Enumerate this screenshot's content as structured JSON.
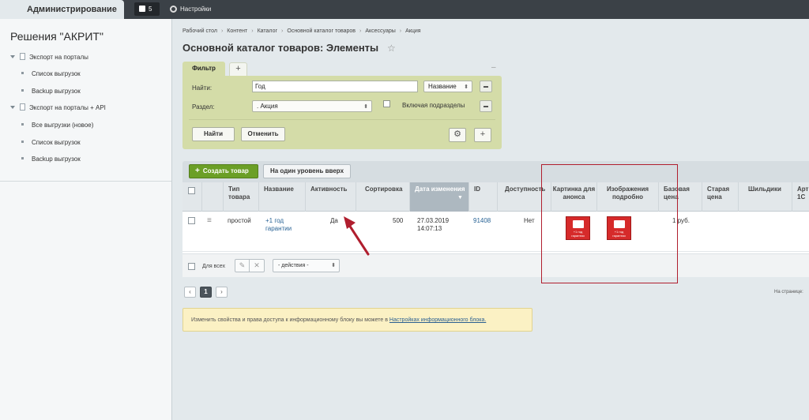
{
  "topbar": {
    "admin_tab": "Администрирование",
    "notif_count": "5",
    "settings": "Настройки"
  },
  "sidebar": {
    "title": "Решения \"АКРИТ\"",
    "items": [
      {
        "label": "Экспорт на порталы"
      },
      {
        "label": "Список выгрузок"
      },
      {
        "label": "Backup выгрузок"
      },
      {
        "label": "Экспорт на порталы + API"
      },
      {
        "label": "Все выгрузки (новое)"
      },
      {
        "label": "Список выгрузок"
      },
      {
        "label": "Backup выгрузок"
      }
    ]
  },
  "breadcrumb": [
    "Рабочий стол",
    "Контент",
    "Каталог",
    "Основной каталог товаров",
    "Аксессуары",
    "Акция"
  ],
  "page_title": "Основной каталог товаров: Элементы",
  "filter": {
    "tab": "Фильтр",
    "add_tab": "+",
    "minimize": "–",
    "find_label": "Найти:",
    "find_value": "Год",
    "find_field": "Название",
    "section_label": "Раздел:",
    "section_value": ". Акция",
    "include_sub": "Включая подразделы",
    "find_btn": "Найти",
    "cancel_btn": "Отменить",
    "plus": "+"
  },
  "toolbar": {
    "create": "Создать товар",
    "create_plus": "+",
    "up_level": "На один уровень вверх"
  },
  "table": {
    "headers": {
      "type": "Тип товара",
      "name": "Название",
      "active": "Активность",
      "sort": "Сортировка",
      "date": "Дата изменения",
      "date_arrow": "▼",
      "id": "ID",
      "avail": "Доступность",
      "preview_pic": "Картинка для анонса",
      "detail_pic": "Изображения подробно",
      "base_price": "Базовая цена",
      "old_price": "Старая цена",
      "badges": "Шильдики",
      "article": "Арт 1С"
    },
    "row": {
      "menu": "≡",
      "type": "простой",
      "name": "+1 год гарантии",
      "active": "Да",
      "sort": "500",
      "date": "27.03.2019 14:07:13",
      "id": "91408",
      "avail": "Нет",
      "thumb_text": "+1 год гарантии",
      "price": "1 руб."
    },
    "footer": {
      "for_all": "Для всех",
      "edit": "✎",
      "delete": "✕",
      "actions": "- действия -"
    }
  },
  "pagination": {
    "prev": "‹",
    "page": "1",
    "next": "›",
    "per_page": "На странице:"
  },
  "notice": {
    "text": "Изменить свойства и права доступа к информационному блоку вы можете в ",
    "link": "Настройках информационного блока."
  },
  "colors": {
    "accent_green": "#6b9f26",
    "filter_bg": "#d4dca8",
    "annotation_red": "#b01e2e"
  }
}
